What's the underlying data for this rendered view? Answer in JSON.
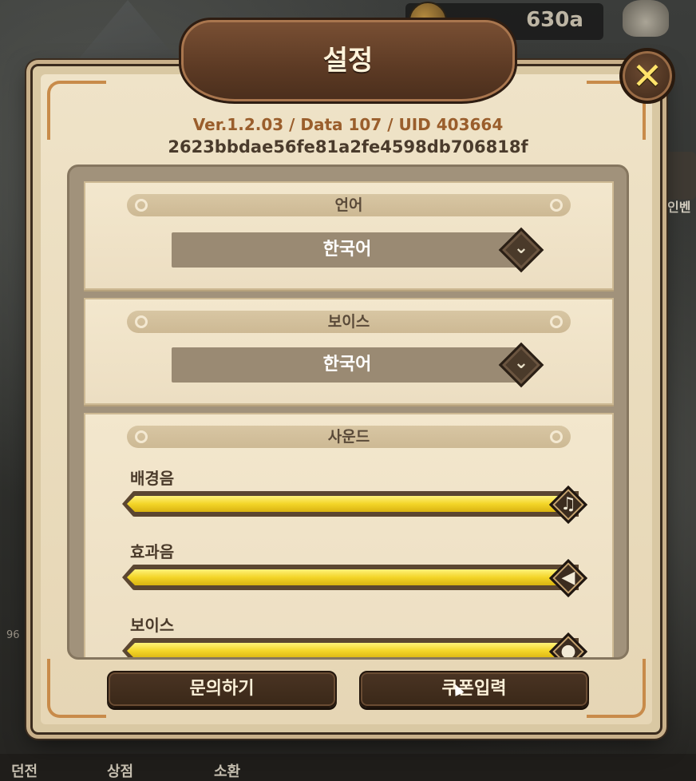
{
  "hud": {
    "currency_value": "630a",
    "side_label": "인벤",
    "left_number": "96",
    "nav_items": [
      "던전",
      "상점",
      "소환"
    ]
  },
  "dialog": {
    "title": "설정",
    "version_line": "Ver.1.2.03 / Data 107 / UID 403664",
    "hash_line": "2623bbdae56fe81a2fe4598db706818f",
    "close_icon": "close-icon"
  },
  "language": {
    "header": "언어",
    "selected": "한국어"
  },
  "voice": {
    "header": "보이스",
    "selected": "한국어"
  },
  "sound": {
    "header": "사운드",
    "sliders": [
      {
        "label": "배경음",
        "level": 1.0,
        "icon": "music-note-icon"
      },
      {
        "label": "효과음",
        "level": 1.0,
        "icon": "speaker-icon"
      },
      {
        "label": "보이스",
        "level": 1.0,
        "icon": "microphone-icon"
      }
    ]
  },
  "buttons": {
    "inquiry": "문의하기",
    "coupon": "쿠폰입력"
  },
  "colors": {
    "slider_fill": "#f3d528",
    "panel_bg": "#efe3c8",
    "title_banner": "#5c3a24",
    "version_text": "#9a5e2c",
    "close_x": "#ffe36a"
  }
}
